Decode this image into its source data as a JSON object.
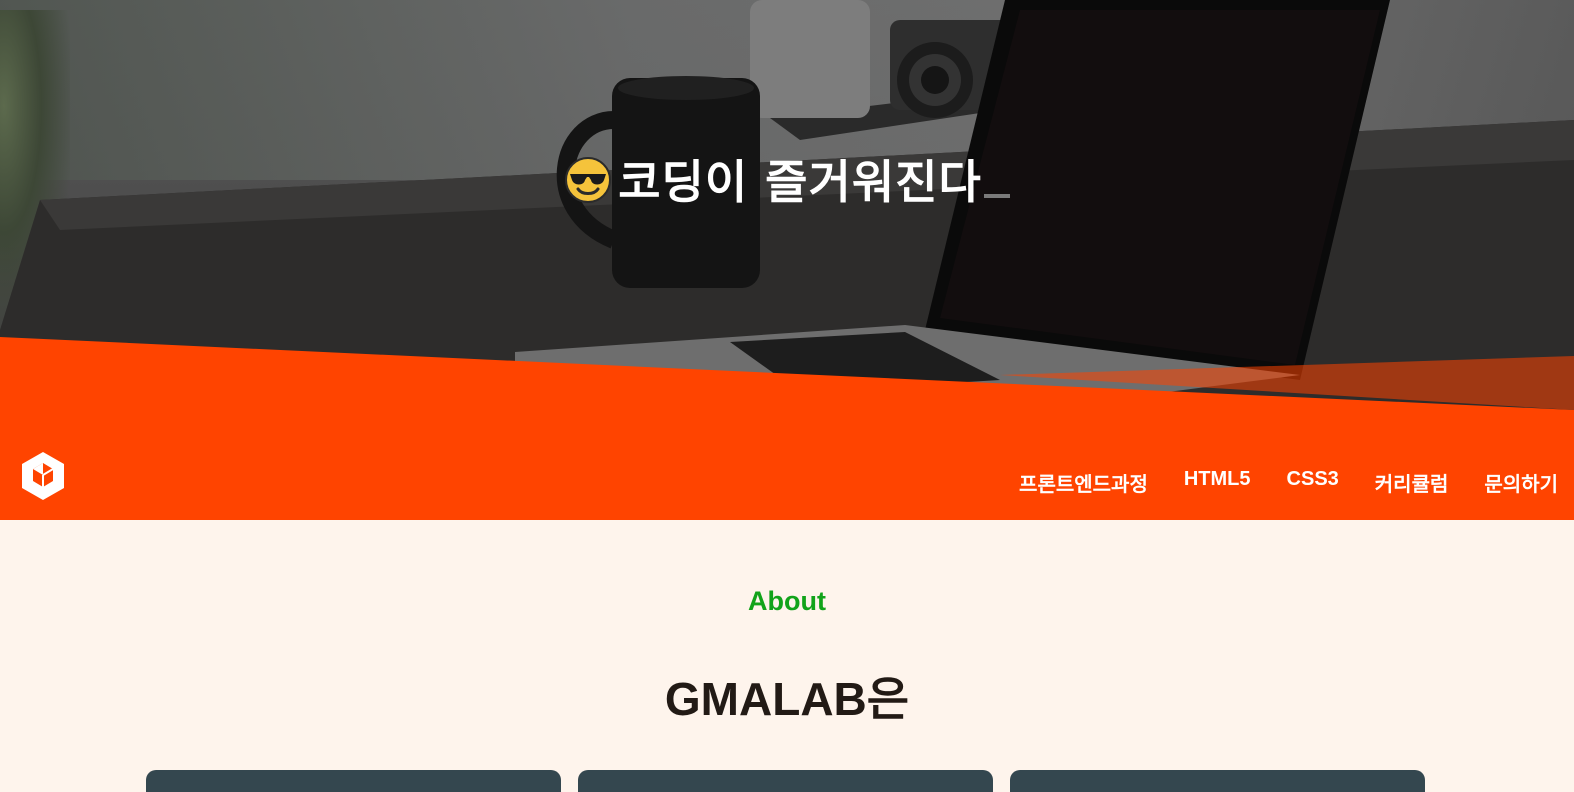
{
  "hero": {
    "emoji": "smiling-face-with-sunglasses",
    "title": "코딩이 즐거워진다"
  },
  "nav": {
    "logo": "cube-logo",
    "items": [
      {
        "label": "프론트엔드과정"
      },
      {
        "label": "HTML5"
      },
      {
        "label": "CSS3"
      },
      {
        "label": "커리큘럼"
      },
      {
        "label": "문의하기"
      }
    ]
  },
  "about": {
    "kicker": "About",
    "heading": "GMALAB은"
  },
  "colors": {
    "accent": "#ff4400",
    "kicker": "#11a31a",
    "background": "#fef4ec",
    "card": "#34474f"
  }
}
